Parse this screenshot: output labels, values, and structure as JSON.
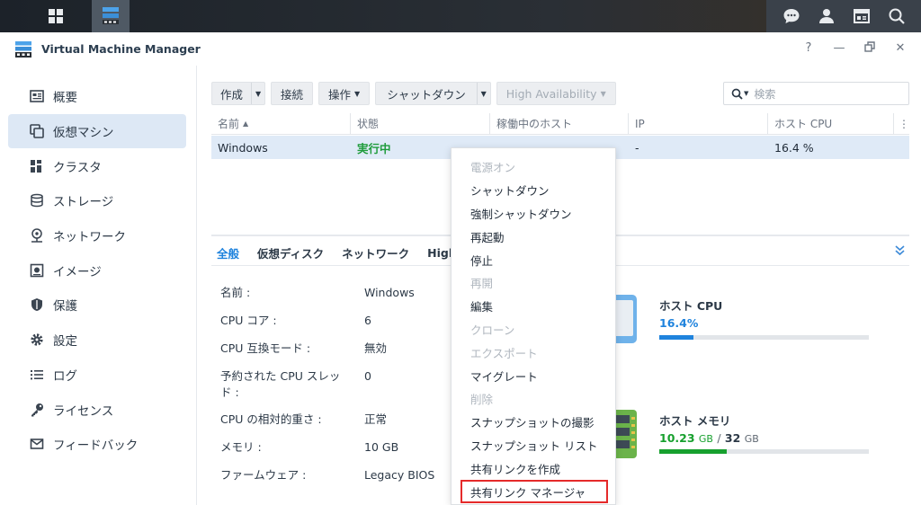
{
  "window": {
    "title": "Virtual Machine Manager"
  },
  "sidebar": {
    "items": [
      {
        "label": "概要",
        "icon": "overview-icon"
      },
      {
        "label": "仮想マシン",
        "icon": "virtual-machine-icon",
        "active": true
      },
      {
        "label": "クラスタ",
        "icon": "cluster-icon"
      },
      {
        "label": "ストレージ",
        "icon": "storage-icon"
      },
      {
        "label": "ネットワーク",
        "icon": "network-icon"
      },
      {
        "label": "イメージ",
        "icon": "image-icon"
      },
      {
        "label": "保護",
        "icon": "shield-icon"
      },
      {
        "label": "設定",
        "icon": "gear-icon"
      },
      {
        "label": "ログ",
        "icon": "log-icon"
      },
      {
        "label": "ライセンス",
        "icon": "key-icon"
      },
      {
        "label": "フィードバック",
        "icon": "mail-icon"
      }
    ]
  },
  "toolbar": {
    "create": "作成",
    "connect": "接続",
    "action": "操作",
    "shutdown": "シャットダウン",
    "high_availability": "High Availability",
    "search_placeholder": "検索"
  },
  "table": {
    "columns": [
      "名前",
      "状態",
      "稼働中のホスト",
      "IP",
      "ホスト CPU"
    ],
    "rows": [
      {
        "name": "Windows",
        "status": "実行中",
        "host": "",
        "ip": "-",
        "cpu": "16.4 %"
      }
    ]
  },
  "detail_tabs": [
    "全般",
    "仮想ディスク",
    "ネットワーク",
    "High A"
  ],
  "fields": [
    {
      "key": "名前 :",
      "value": "Windows"
    },
    {
      "key": "CPU コア :",
      "value": "6"
    },
    {
      "key": "CPU 互換モード :",
      "value": "無効"
    },
    {
      "key": "予約された CPU スレッド :",
      "value": "0"
    },
    {
      "key": "CPU の相対的重さ :",
      "value": "正常"
    },
    {
      "key": "メモリ :",
      "value": "10 GB"
    },
    {
      "key": "ファームウェア :",
      "value": "Legacy BIOS"
    }
  ],
  "resources": {
    "cpu": {
      "title": "ホスト CPU",
      "value": "16.4",
      "unit": "%",
      "fraction": 0.164,
      "color": "#1f83dd"
    },
    "memory": {
      "title": "ホスト メモリ",
      "used": "10.23",
      "used_unit": "GB",
      "sep": "/",
      "total": "32",
      "total_unit": "GB",
      "fraction": 0.32,
      "color": "#17a02e"
    }
  },
  "context_menu": [
    {
      "label": "電源オン",
      "disabled": true
    },
    {
      "label": "シャットダウン",
      "disabled": false
    },
    {
      "label": "強制シャットダウン",
      "disabled": false
    },
    {
      "label": "再起動",
      "disabled": false
    },
    {
      "label": "停止",
      "disabled": false
    },
    {
      "label": "再開",
      "disabled": true
    },
    {
      "label": "編集",
      "disabled": false
    },
    {
      "label": "クローン",
      "disabled": true
    },
    {
      "label": "エクスポート",
      "disabled": true
    },
    {
      "label": "マイグレート",
      "disabled": false
    },
    {
      "label": "削除",
      "disabled": true
    },
    {
      "label": "スナップショットの撮影",
      "disabled": false
    },
    {
      "label": "スナップショット リスト",
      "disabled": false
    },
    {
      "label": "共有リンクを作成",
      "disabled": false
    },
    {
      "label": "共有リンク マネージャ",
      "disabled": false,
      "highlighted": true
    }
  ],
  "colors": {
    "accent": "#1f83dd",
    "running": "#1e9b3b",
    "highlight_box": "#e52a2a"
  }
}
